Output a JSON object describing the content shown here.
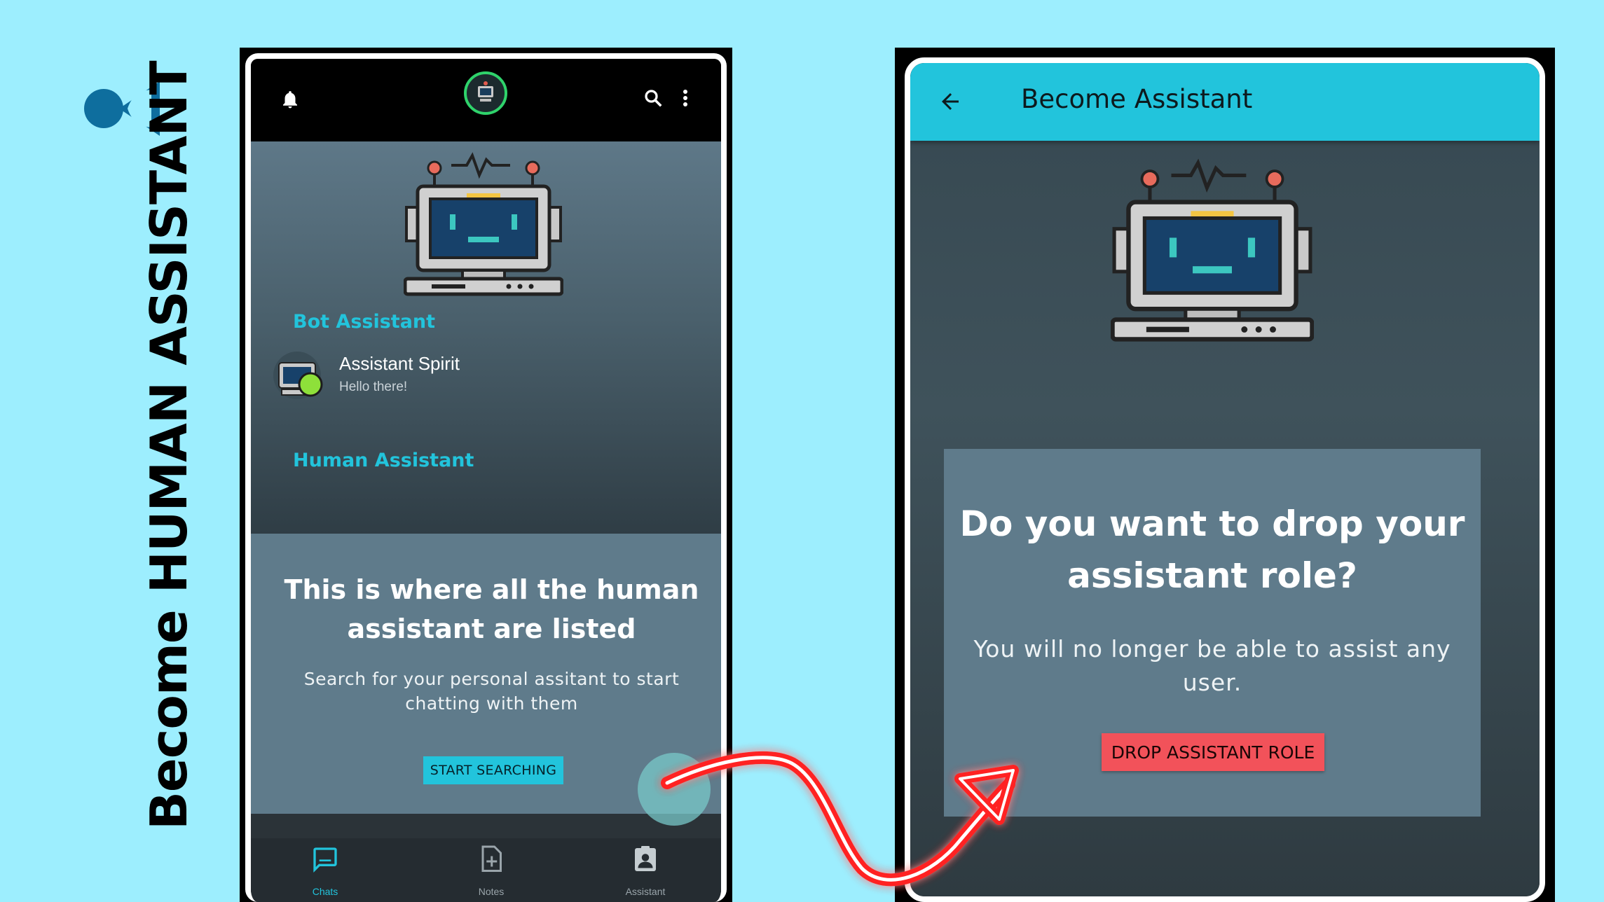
{
  "side_title": {
    "part1": "Become ",
    "part2": "Human Assistant"
  },
  "left_phone": {
    "top_bar": {
      "icons": [
        "bell-icon",
        "robot-avatar-icon",
        "search-icon",
        "more-vert-icon"
      ]
    },
    "sections": {
      "bot_label": "Bot Assistant",
      "human_label": "Human Assistant"
    },
    "bot_chat": {
      "name": "Assistant Spirit",
      "preview": "Hello there!"
    },
    "empty_state": {
      "title": "This is where all the human assistant are listed",
      "subtitle": "Search for your personal assitant to start chatting with them",
      "button": "START SEARCHING"
    },
    "bottom_nav": [
      {
        "label": "Chats",
        "icon": "chat-icon",
        "active": true
      },
      {
        "label": "Notes",
        "icon": "note-add-icon",
        "active": false
      },
      {
        "label": "Assistant",
        "icon": "assignment-ind-icon",
        "active": false
      }
    ]
  },
  "right_phone": {
    "app_bar": {
      "title": "Become Assistant",
      "back_icon": "arrow-back-icon"
    },
    "dialog": {
      "title": "Do you want to drop your assistant role?",
      "message": "You will no longer be able to assist any user.",
      "button": "DROP ASSISTANT ROLE"
    }
  },
  "colors": {
    "background": "#9deefe",
    "accent": "#22c4dc",
    "danger": "#f2525a",
    "card": "#5f7b8b",
    "arrow": "#ff1a1a"
  }
}
